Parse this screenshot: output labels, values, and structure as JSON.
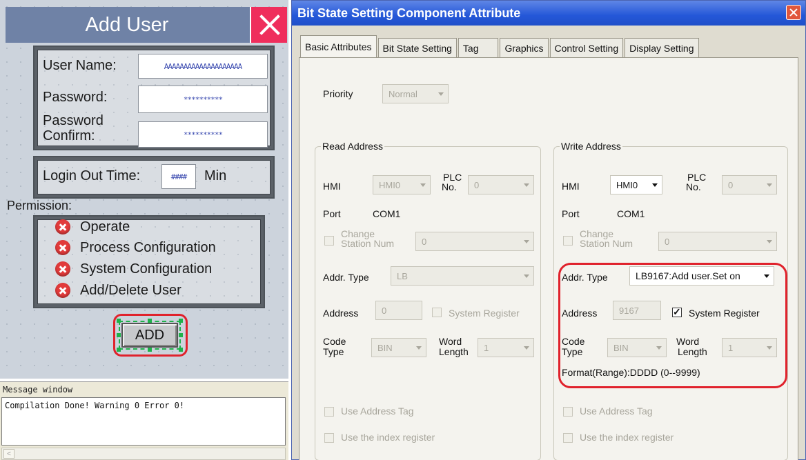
{
  "add_user": {
    "title": "Add User",
    "user_name_label": "User Name:",
    "user_name_value": "AAAAAAAAAAAAAAAAAAAA",
    "password_label": "Password:",
    "password_value": "**********",
    "password_confirm_label_1": "Password",
    "password_confirm_label_2": "Confirm:",
    "password_confirm_value": "**********",
    "logout_label": "Login Out Time:",
    "logout_value": "####",
    "logout_unit": "Min",
    "permission_label": "Permission:",
    "permissions": [
      "Operate",
      "Process Configuration",
      "System Configuration",
      "Add/Delete User"
    ],
    "add_button": "ADD"
  },
  "message_window": {
    "title": "Message window",
    "text": "Compilation Done! Warning 0 Error 0!",
    "scroll_left": "<"
  },
  "dialog": {
    "title": "Bit State Setting Component Attribute",
    "tabs": [
      "Basic Attributes",
      "Bit State Setting",
      "Tag",
      "Graphics",
      "Control Setting",
      "Display Setting"
    ],
    "priority_label": "Priority",
    "priority_value": "Normal",
    "read": {
      "group": "Read Address",
      "hmi_label": "HMI",
      "hmi_value": "HMI0",
      "plc_label_1": "PLC",
      "plc_label_2": "No.",
      "plc_value": "0",
      "port_label": "Port",
      "port_value": "COM1",
      "change_label_1": "Change",
      "change_label_2": "Station Num",
      "change_value": "0",
      "addr_type_label": "Addr. Type",
      "addr_type_value": "LB",
      "address_label": "Address",
      "address_value": "0",
      "system_register": "System Register",
      "code_label_1": "Code",
      "code_label_2": "Type",
      "code_value": "BIN",
      "word_label_1": "Word",
      "word_label_2": "Length",
      "word_value": "1",
      "use_address_tag": "Use Address Tag",
      "use_index_register": "Use the index register"
    },
    "write": {
      "group": "Write Address",
      "hmi_label": "HMI",
      "hmi_value": "HMI0",
      "plc_label_1": "PLC",
      "plc_label_2": "No.",
      "plc_value": "0",
      "port_label": "Port",
      "port_value": "COM1",
      "change_label_1": "Change",
      "change_label_2": "Station Num",
      "change_value": "0",
      "addr_type_label": "Addr. Type",
      "addr_type_value": "LB9167:Add user.Set on",
      "address_label": "Address",
      "address_value": "9167",
      "system_register": "System Register",
      "code_label_1": "Code",
      "code_label_2": "Type",
      "code_value": "BIN",
      "word_label_1": "Word",
      "word_label_2": "Length",
      "word_value": "1",
      "format": "Format(Range):DDDD (0--9999)",
      "use_address_tag": "Use Address Tag",
      "use_index_register": "Use the index register"
    }
  },
  "colors": {
    "accent_red": "#e0222c",
    "title_blue": "#2457d8",
    "panel_dark": "#5b6168",
    "close_pink": "#ef2e5c"
  }
}
